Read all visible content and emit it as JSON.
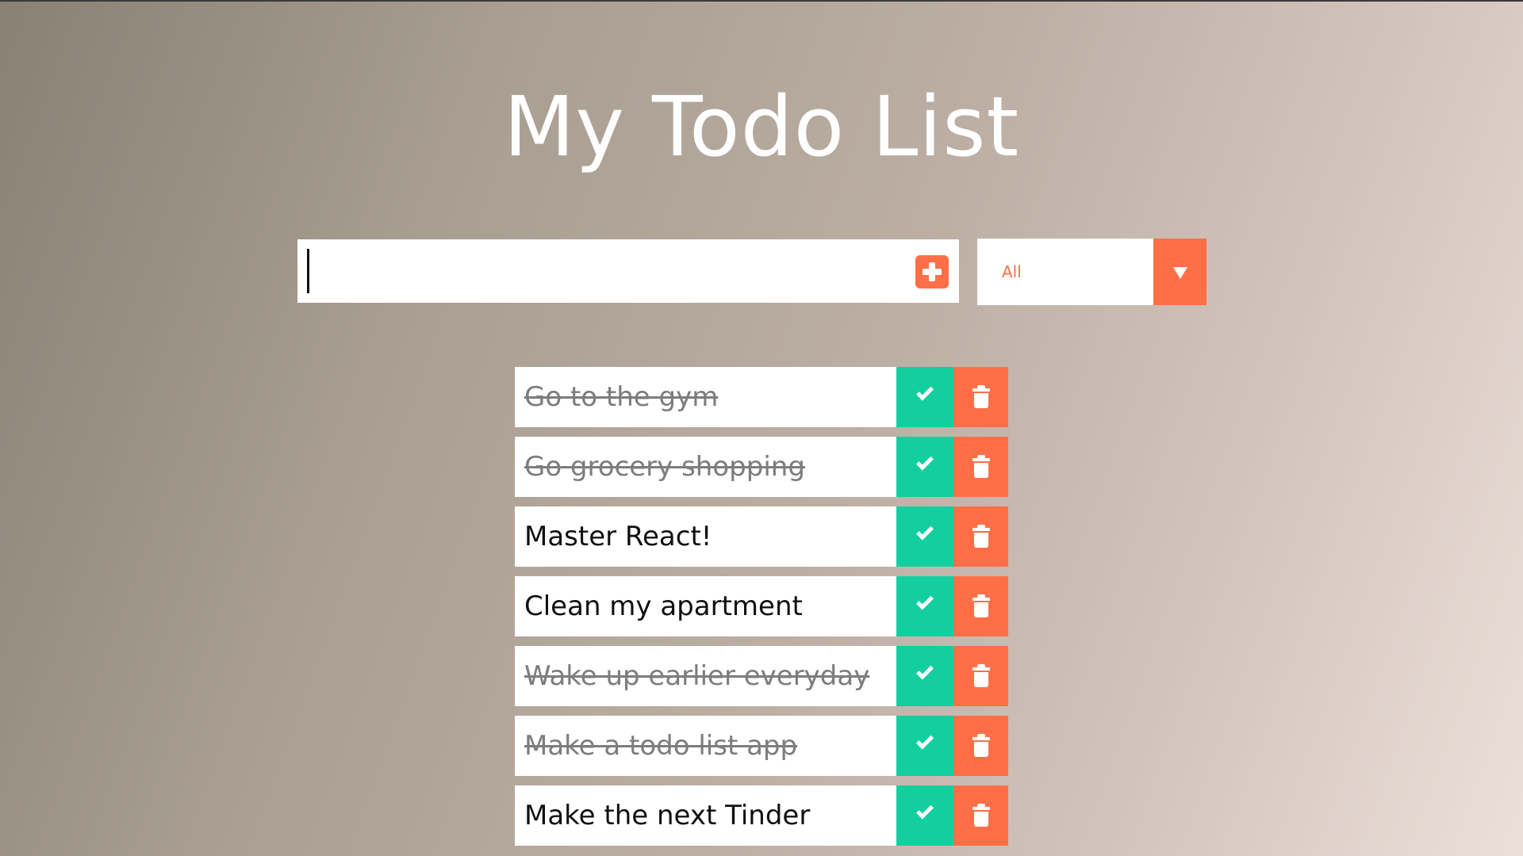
{
  "app": {
    "title": "My Todo List"
  },
  "form": {
    "input_value": "",
    "input_placeholder": "",
    "add_icon": "plus-square-icon"
  },
  "filter": {
    "selected": "All",
    "icon": "caret-down-icon"
  },
  "todos": [
    {
      "text": "Go to the gym",
      "completed": true
    },
    {
      "text": "Go grocery shopping",
      "completed": true
    },
    {
      "text": "Master React!",
      "completed": false
    },
    {
      "text": "Clean my apartment",
      "completed": false
    },
    {
      "text": "Wake up earlier everyday",
      "completed": true
    },
    {
      "text": "Make a todo list app",
      "completed": true
    },
    {
      "text": "Make the next Tinder",
      "completed": false
    }
  ],
  "item_actions": {
    "complete_icon": "check-icon",
    "delete_icon": "trash-icon"
  },
  "colors": {
    "accent": "#ff6f47",
    "complete": "#13cf9f",
    "completed_text": "#7d7d7d"
  }
}
